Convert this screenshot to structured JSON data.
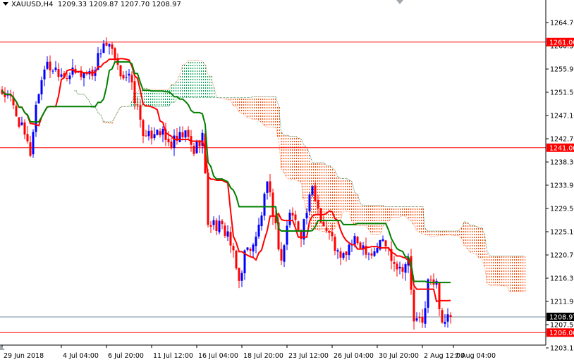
{
  "header": {
    "symbol": "XAUUSD,H4",
    "open": "1209.33",
    "high": "1209.87",
    "low": "1207.70",
    "close": "1208.97"
  },
  "chart_data": {
    "type": "candlestick",
    "title": "XAUUSD,H4",
    "indicator": "Ichimoku Kinko Hyo (9,26,52)",
    "ylim": [
      1203.1,
      1268.9
    ],
    "y_ticks": [
      "1264.70",
      "1260.30",
      "1255.90",
      "1251.50",
      "1247.10",
      "1242.70",
      "1238.30",
      "1233.90",
      "1229.50",
      "1225.10",
      "1220.70",
      "1216.30",
      "1211.90",
      "1207.50",
      "1203.10"
    ],
    "x_ticks": [
      {
        "bar": 0,
        "label": "29 Jun 2018"
      },
      {
        "bar": 21,
        "label": "4 Jul 04:00"
      },
      {
        "bar": 37,
        "label": "6 Jul 20:00"
      },
      {
        "bar": 53,
        "label": "11 Jul 12:00"
      },
      {
        "bar": 69,
        "label": "16 Jul 04:00"
      },
      {
        "bar": 85,
        "label": "18 Jul 20:00"
      },
      {
        "bar": 101,
        "label": "23 Jul 12:00"
      },
      {
        "bar": 117,
        "label": "26 Jul 04:00"
      },
      {
        "bar": 133,
        "label": "30 Jul 20:00"
      },
      {
        "bar": 149,
        "label": "2 Aug 12:00"
      },
      {
        "bar": 160,
        "label": "7 Aug 04:00"
      }
    ],
    "close_keypoints": [
      [
        0,
        1251.5
      ],
      [
        3,
        1250
      ],
      [
        6,
        1246
      ],
      [
        10,
        1240
      ],
      [
        12,
        1249
      ],
      [
        15,
        1256.5
      ],
      [
        19,
        1256
      ],
      [
        22,
        1255
      ],
      [
        27,
        1255
      ],
      [
        32,
        1255.2
      ],
      [
        36,
        1261
      ],
      [
        39,
        1259
      ],
      [
        41,
        1255.6
      ],
      [
        45,
        1254.3
      ],
      [
        49,
        1246.3
      ],
      [
        51,
        1242.3
      ],
      [
        55,
        1245
      ],
      [
        59,
        1241.6
      ],
      [
        62,
        1242.3
      ],
      [
        65,
        1243.6
      ],
      [
        68,
        1240.3
      ],
      [
        71,
        1243.6
      ],
      [
        73,
        1227
      ],
      [
        76,
        1226.3
      ],
      [
        80,
        1225
      ],
      [
        84,
        1215.6
      ],
      [
        86,
        1221
      ],
      [
        90,
        1223.6
      ],
      [
        94,
        1233.6
      ],
      [
        96,
        1229
      ],
      [
        99,
        1219.6
      ],
      [
        102,
        1229
      ],
      [
        106,
        1225
      ],
      [
        110,
        1233
      ],
      [
        114,
        1226.3
      ],
      [
        117,
        1223.6
      ],
      [
        120,
        1219.6
      ],
      [
        124,
        1223
      ],
      [
        127,
        1223
      ],
      [
        131,
        1221
      ],
      [
        135,
        1223.6
      ],
      [
        139,
        1219.6
      ],
      [
        141,
        1218.3
      ],
      [
        144,
        1219.6
      ],
      [
        146,
        1208.3
      ],
      [
        149,
        1207.6
      ],
      [
        151,
        1215.6
      ],
      [
        154,
        1215
      ],
      [
        156,
        1208.3
      ],
      [
        159,
        1208.97
      ]
    ],
    "horizontal_lines": [
      {
        "price": 1261.0,
        "label": "1261.00",
        "color": "#ff0000"
      },
      {
        "price": 1241.0,
        "label": "1241.00",
        "color": "#ff0000"
      },
      {
        "price": 1206.0,
        "label": "1206.00",
        "color": "#ff0000"
      }
    ],
    "current_price": {
      "price": 1208.97,
      "label": "1208.97"
    },
    "colors": {
      "bull": "#0000ff",
      "bear": "#ff0000",
      "tenkan": "#ff0000",
      "kijun": "#008000",
      "cloud_bear": "#ff4500",
      "cloud_bull": "#00a050"
    }
  }
}
